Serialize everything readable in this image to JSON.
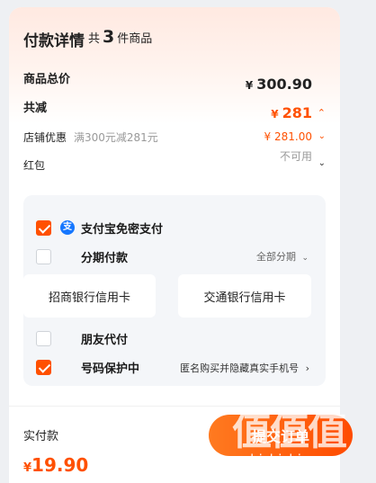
{
  "header": {
    "title": "付款详情",
    "count_prefix": "共",
    "count": "3",
    "count_suffix": "件商品"
  },
  "summary": {
    "total_label": "商品总价",
    "total_currency": "¥",
    "total_value": "300.90",
    "reduce_label": "共减",
    "reduce_currency": "¥",
    "reduce_value": "281",
    "shop_label": "店铺优惠",
    "shop_desc": "满300元减281元",
    "shop_currency": "¥",
    "shop_value": "281.00",
    "redpacket_label": "红包",
    "redpacket_status": "不可用"
  },
  "payment": {
    "alipay_label": "支付宝免密支付",
    "alipay_icon": "支",
    "installment_label": "分期付款",
    "installment_action": "全部分期",
    "banks": [
      "招商银行信用卡",
      "交通银行信用卡"
    ],
    "friend_label": "朋友代付",
    "privacy_label": "号码保护中",
    "privacy_desc": "匿名购买并隐藏真实手机号"
  },
  "footer": {
    "paid_label": "实付款",
    "paid_currency": "¥",
    "paid_value": "19.90",
    "pay_button": "提交订单"
  },
  "watermark": {
    "glyphs": "值值值",
    "url": "zhizhizhi.com"
  },
  "colors": {
    "accent": "#ff5000",
    "alipay": "#1677ff",
    "panel": "#f4f6f9"
  }
}
